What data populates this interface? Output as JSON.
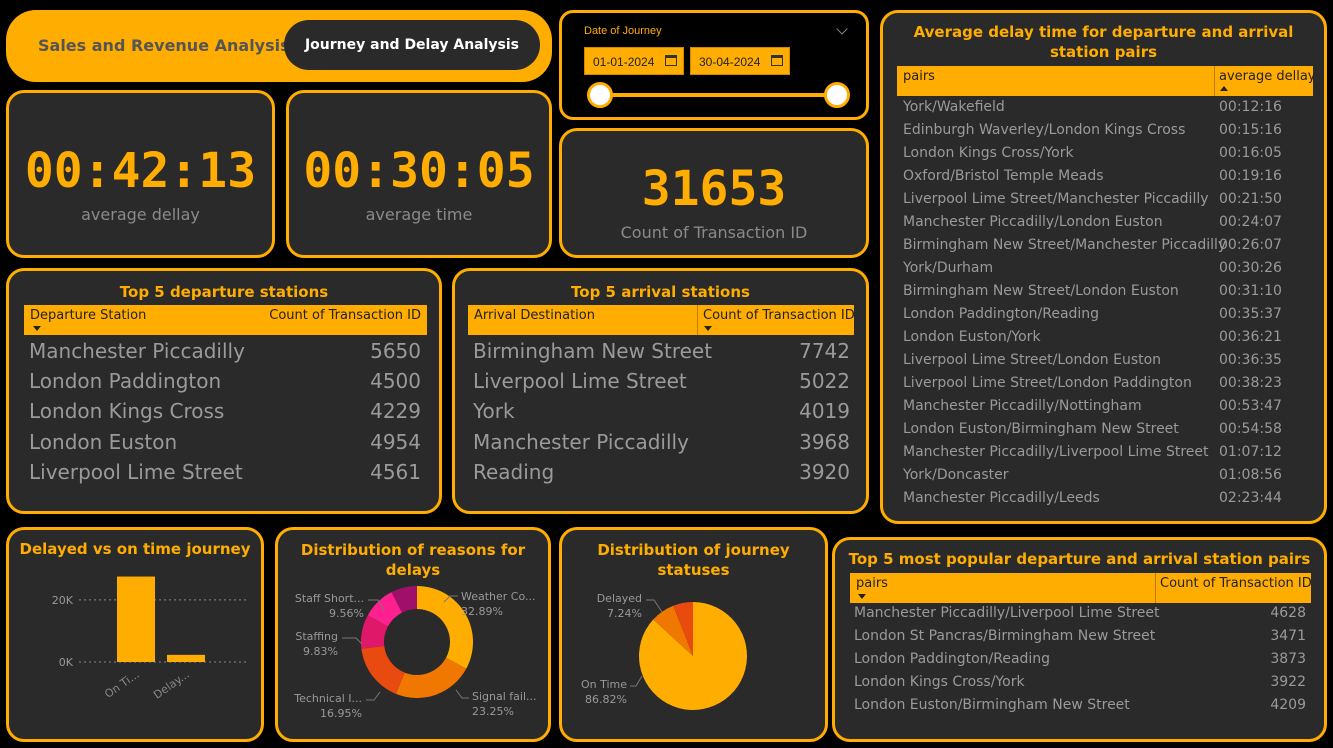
{
  "nav": {
    "tab_sales": "Sales and Revenue Analysis",
    "tab_journey": "Journey and Delay Analysis"
  },
  "date_slicer": {
    "title": "Date of Journey",
    "start": "01-01-2024",
    "end": "30-04-2024"
  },
  "kpis": {
    "avg_delay": {
      "value": "00:42:13",
      "label": "average dellay"
    },
    "avg_time": {
      "value": "00:30:05",
      "label": "average time"
    },
    "count": {
      "value": "31653",
      "label": "Count of Transaction ID"
    }
  },
  "departures": {
    "title": "Top 5 departure stations",
    "col1": "Departure Station",
    "col2": "Count of Transaction ID",
    "rows": [
      {
        "name": "Manchester Piccadilly",
        "count": "5650"
      },
      {
        "name": "London Paddington",
        "count": "4500"
      },
      {
        "name": "London Kings Cross",
        "count": "4229"
      },
      {
        "name": "London Euston",
        "count": "4954"
      },
      {
        "name": "Liverpool Lime Street",
        "count": "4561"
      }
    ]
  },
  "arrivals": {
    "title": "Top 5 arrival stations",
    "col1": "Arrival Destination",
    "col2": "Count of Transaction ID",
    "rows": [
      {
        "name": "Birmingham New Street",
        "count": "7742"
      },
      {
        "name": "Liverpool Lime Street",
        "count": "5022"
      },
      {
        "name": "York",
        "count": "4019"
      },
      {
        "name": "Manchester Piccadilly",
        "count": "3968"
      },
      {
        "name": "Reading",
        "count": "3920"
      }
    ]
  },
  "delay_pairs": {
    "title": "Average delay time for departure and arrival station pairs",
    "col1": "pairs",
    "col2": "average dellay",
    "rows": [
      {
        "pair": "York/Wakefield",
        "delay": "00:12:16"
      },
      {
        "pair": "Edinburgh Waverley/London Kings Cross",
        "delay": "00:15:16"
      },
      {
        "pair": "London Kings Cross/York",
        "delay": "00:16:05"
      },
      {
        "pair": "Oxford/Bristol Temple Meads",
        "delay": "00:19:16"
      },
      {
        "pair": "Liverpool Lime Street/Manchester Piccadilly",
        "delay": "00:21:50"
      },
      {
        "pair": "Manchester Piccadilly/London Euston",
        "delay": "00:24:07"
      },
      {
        "pair": "Birmingham New Street/Manchester Piccadilly",
        "delay": "00:26:07"
      },
      {
        "pair": "York/Durham",
        "delay": "00:30:26"
      },
      {
        "pair": "Birmingham New Street/London Euston",
        "delay": "00:31:10"
      },
      {
        "pair": "London Paddington/Reading",
        "delay": "00:35:37"
      },
      {
        "pair": "London Euston/York",
        "delay": "00:36:21"
      },
      {
        "pair": "Liverpool Lime Street/London Euston",
        "delay": "00:36:35"
      },
      {
        "pair": "Liverpool Lime Street/London Paddington",
        "delay": "00:38:23"
      },
      {
        "pair": "Manchester Piccadilly/Nottingham",
        "delay": "00:53:47"
      },
      {
        "pair": "London Euston/Birmingham New Street",
        "delay": "00:54:58"
      },
      {
        "pair": "Manchester Piccadilly/Liverpool Lime Street",
        "delay": "01:07:12"
      },
      {
        "pair": "York/Doncaster",
        "delay": "01:08:56"
      },
      {
        "pair": "Manchester Piccadilly/Leeds",
        "delay": "02:23:44"
      }
    ]
  },
  "popular_pairs": {
    "title": "Top 5 most popular departure and arrival station pairs",
    "col1": "pairs",
    "col2": "Count of Transaction ID",
    "rows": [
      {
        "pair": "Manchester Piccadilly/Liverpool Lime Street",
        "count": "4628"
      },
      {
        "pair": "London St Pancras/Birmingham New Street",
        "count": "3471"
      },
      {
        "pair": "London Paddington/Reading",
        "count": "3873"
      },
      {
        "pair": "London Kings Cross/York",
        "count": "3922"
      },
      {
        "pair": "London Euston/Birmingham New Street",
        "count": "4209"
      }
    ]
  },
  "colors": {
    "accent": "#ffad00",
    "panel": "#2a2a2a",
    "text": "#9a9a9a"
  },
  "chart_data": [
    {
      "type": "bar",
      "title": "Delayed vs on time journey",
      "categories": [
        "On Ti...",
        "Delay..."
      ],
      "values": [
        27500,
        2300
      ],
      "yticks": [
        "20K",
        "0K"
      ],
      "ylim": [
        0,
        28000
      ]
    },
    {
      "type": "pie",
      "variant": "donut",
      "title": "Distribution of reasons for delays",
      "slices": [
        {
          "label": "Weather Co...",
          "pct": "32.89%",
          "value": 32.89,
          "color": "#ffad00"
        },
        {
          "label": "Signal fail...",
          "pct": "23.25%",
          "value": 23.25,
          "color": "#f07800"
        },
        {
          "label": "Technical I...",
          "pct": "16.95%",
          "value": 16.95,
          "color": "#e84a10"
        },
        {
          "label": "Staffing",
          "pct": "9.83%",
          "value": 9.83,
          "color": "#e0186a"
        },
        {
          "label": "Staff Short...",
          "pct": "9.56%",
          "value": 9.56,
          "color": "#ff2090"
        },
        {
          "label": "",
          "pct": "",
          "value": 7.52,
          "color": "#a0106a"
        }
      ]
    },
    {
      "type": "pie",
      "title": "Distribution of journey statuses",
      "slices": [
        {
          "label": "On Time",
          "pct": "86.82%",
          "value": 86.82,
          "color": "#ffad00"
        },
        {
          "label": "Delayed",
          "pct": "7.24%",
          "value": 7.24,
          "color": "#f07800"
        },
        {
          "label": "",
          "pct": "",
          "value": 5.94,
          "color": "#e84a10"
        }
      ]
    }
  ]
}
